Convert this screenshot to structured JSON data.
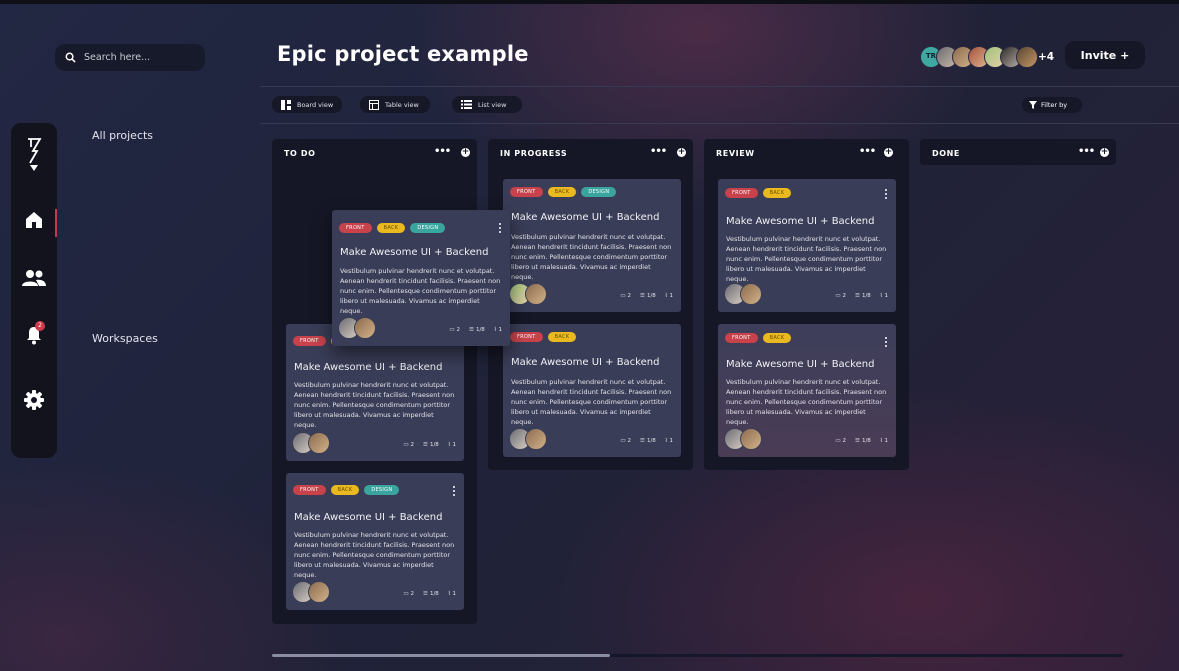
{
  "search": {
    "placeholder": "Search here..."
  },
  "nav": {
    "all_projects": "All projects",
    "workspaces": "Workspaces",
    "notification_count": "2"
  },
  "header": {
    "title": "Epic project example",
    "avatar_initials": "TR",
    "more_members": "+4",
    "invite_label": "Invite +"
  },
  "views": {
    "board": "Board view",
    "table": "Table view",
    "list": "List view",
    "filter": "Filter by"
  },
  "columns": [
    {
      "title": "TO DO"
    },
    {
      "title": "IN PROGRESS"
    },
    {
      "title": "REVIEW"
    },
    {
      "title": "DONE"
    }
  ],
  "card": {
    "title": "Make Awesome UI + Backend",
    "description": "Vestibulum pulvinar hendrerit nunc et volutpat. Aenean hendrerit tincidunt facilisis. Praesent non nunc enim. Pellentesque condimentum porttitor libero ut malesuada. Vivamus ac imperdiet neque.",
    "tag_front": "FRONT",
    "tag_back": "BACK",
    "tag_design": "DESIGN",
    "comments": "2",
    "checklist": "1/8",
    "attachments": "1"
  },
  "colors": {
    "accent": "#c43a4e",
    "front": "#c8424c",
    "back": "#e9b91f",
    "design": "#3aa59e",
    "column_bg": "#151726",
    "card_bg": "#3a3d57"
  },
  "icons": [
    "search-icon",
    "logo-icon",
    "home-icon",
    "team-icon",
    "bell-icon",
    "gear-icon",
    "board-view-icon",
    "table-view-icon",
    "list-view-icon",
    "filter-icon",
    "comment-icon",
    "checklist-icon",
    "attachment-icon",
    "more-icon",
    "plus-icon",
    "kebab-icon"
  ]
}
